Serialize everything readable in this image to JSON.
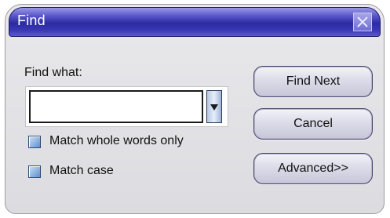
{
  "window": {
    "title": "Find"
  },
  "form": {
    "find_what_label": "Find what:",
    "find_value": "",
    "match_whole_words_label": "Match whole words only",
    "match_whole_words_checked": false,
    "match_case_label": "Match case",
    "match_case_checked": false
  },
  "buttons": {
    "find_next": "Find Next",
    "cancel": "Cancel",
    "advanced": "Advanced>>"
  },
  "colors": {
    "titlebar": "#2c2ba0",
    "dialog_background": "#e2e2e6",
    "checkbox": "#5c8fcf"
  },
  "icons": {
    "close": "close-x-icon",
    "dropdown": "chevron-down-icon"
  }
}
